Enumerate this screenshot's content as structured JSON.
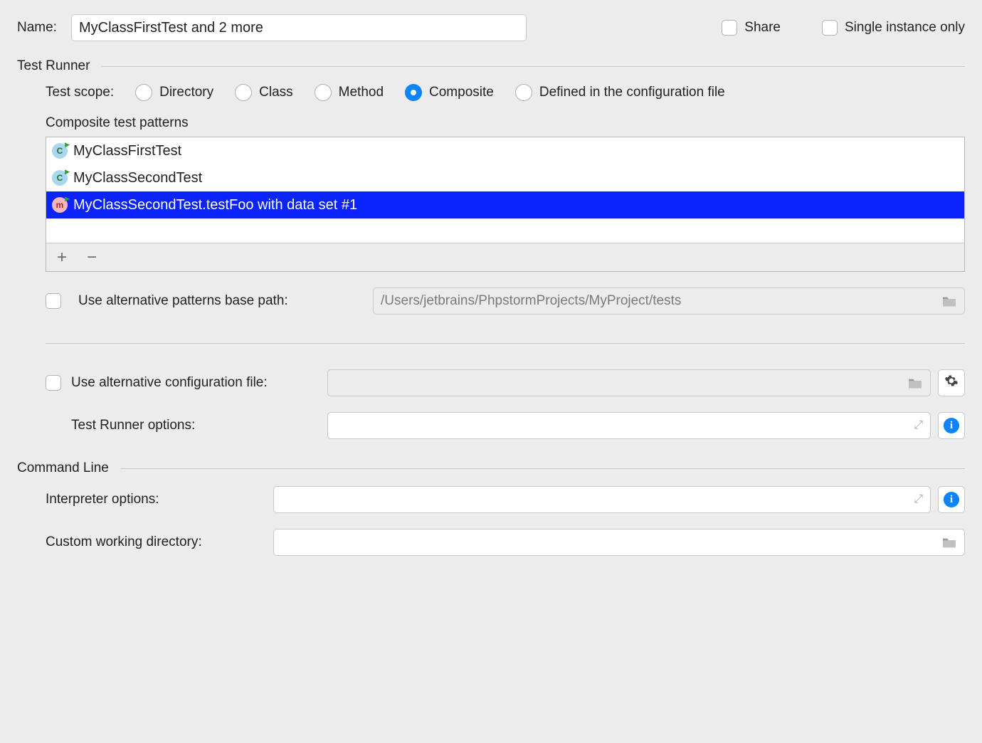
{
  "header": {
    "name_label": "Name:",
    "name_value": "MyClassFirstTest and 2 more",
    "share_label": "Share",
    "single_instance_label": "Single instance only"
  },
  "test_runner": {
    "section_title": "Test Runner",
    "scope_label": "Test scope:",
    "options": {
      "directory": "Directory",
      "class": "Class",
      "method": "Method",
      "composite": "Composite",
      "defined": "Defined in the configuration file"
    },
    "selected": "composite",
    "composite_patterns_label": "Composite test patterns",
    "patterns": [
      {
        "name": "MyClassFirstTest",
        "icon": "class",
        "selected": false
      },
      {
        "name": "MyClassSecondTest",
        "icon": "class",
        "selected": false
      },
      {
        "name": "MyClassSecondTest.testFoo with data set #1",
        "icon": "method",
        "selected": true
      }
    ],
    "alt_path_label": "Use alternative patterns base path:",
    "alt_path_value": "/Users/jetbrains/PhpstormProjects/MyProject/tests",
    "alt_config_label": "Use alternative configuration file:",
    "runner_options_label": "Test Runner options:"
  },
  "command_line": {
    "section_title": "Command Line",
    "interpreter_label": "Interpreter options:",
    "working_dir_label": "Custom working directory:"
  }
}
